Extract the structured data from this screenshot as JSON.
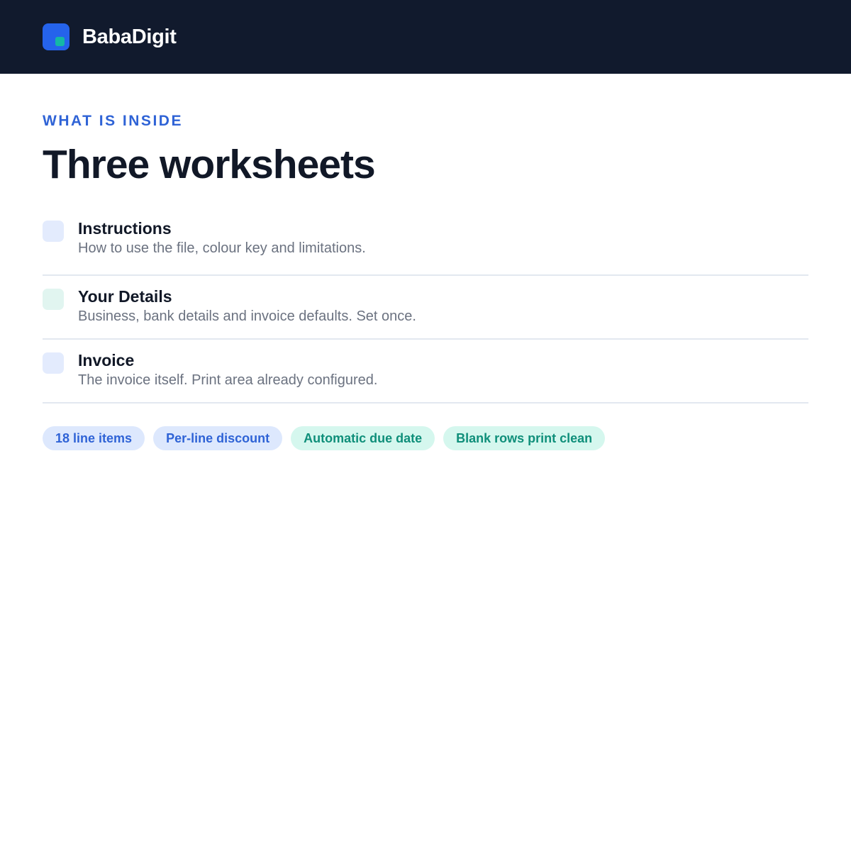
{
  "header": {
    "brand": "BabaDigit",
    "logo_icon": "babadigit-logo-icon",
    "background_color": "#111a2d",
    "logo_color": "#2563eb",
    "logo_accent_color": "#14b8a6"
  },
  "section": {
    "eyebrow": "WHAT IS INSIDE",
    "title": "Three worksheets",
    "eyebrow_color": "#2f63d6"
  },
  "worksheets": [
    {
      "title": "Instructions",
      "description": "How to use the file, colour key and limitations.",
      "swatch_color": "#e3ebfd"
    },
    {
      "title": "Your Details",
      "description": "Business, bank details and invoice defaults. Set once.",
      "swatch_color": "#e1f5f0"
    },
    {
      "title": "Invoice",
      "description": "The invoice itself. Print area already configured.",
      "swatch_color": "#e3ebfd"
    }
  ],
  "tags": [
    {
      "label": "18 line items",
      "text_color": "#2f63d6",
      "bg_color": "#dde8fd"
    },
    {
      "label": "Per-line discount",
      "text_color": "#2f63d6",
      "bg_color": "#dde8fd"
    },
    {
      "label": "Automatic due date",
      "text_color": "#0f8f7a",
      "bg_color": "#d5f7ee"
    },
    {
      "label": "Blank rows print clean",
      "text_color": "#0f8f7a",
      "bg_color": "#d5f7ee"
    }
  ]
}
